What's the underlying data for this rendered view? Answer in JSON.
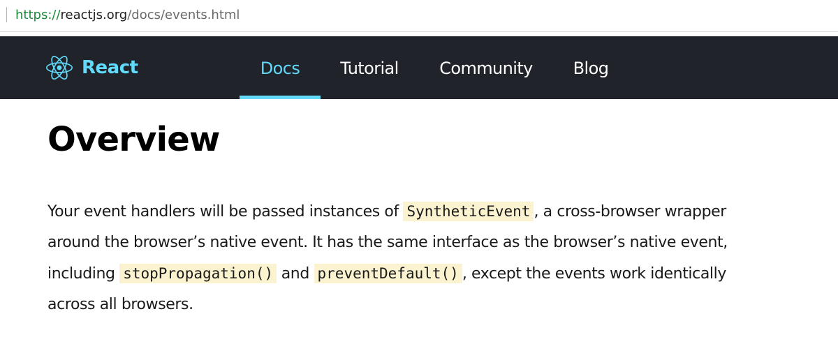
{
  "browser": {
    "url_scheme": "https://",
    "url_host": "reactjs.org",
    "url_path": "/docs/events.html"
  },
  "nav": {
    "logo_icon": "react-atom-icon",
    "brand": "React",
    "accent_color": "#61dafb",
    "background_color": "#20232a",
    "items": [
      {
        "label": "Docs",
        "active": true
      },
      {
        "label": "Tutorial",
        "active": false
      },
      {
        "label": "Community",
        "active": false
      },
      {
        "label": "Blog",
        "active": false
      }
    ]
  },
  "article": {
    "title": "Overview",
    "paragraph": {
      "line1_before": "Your event handlers will be passed instances of ",
      "code_synthetic": "SyntheticEvent",
      "line1_after": ", a cross-browser wrapper",
      "line2": "around the browser’s native event. It has the same interface as the browser’s native event,",
      "line3_before": "including ",
      "code_stop": "stopPropagation()",
      "line3_mid": " and ",
      "code_prevent": "preventDefault()",
      "line3_after": ", except the events work identically",
      "line4": "across all browsers."
    }
  }
}
